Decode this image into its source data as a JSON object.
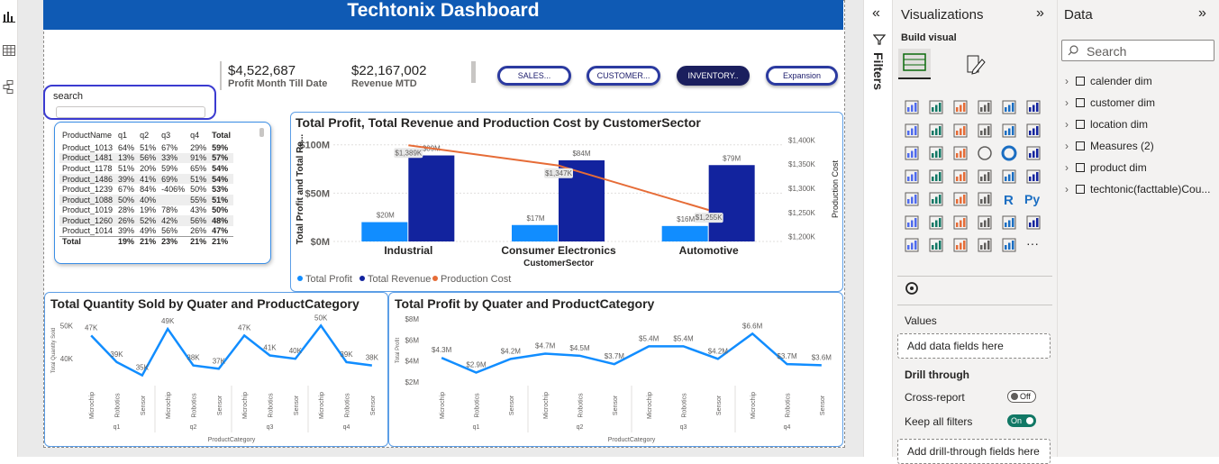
{
  "dashboard": {
    "title": "Techtonix Dashboard"
  },
  "kpis": [
    {
      "value": "$4,522,687",
      "label": "Profit Month Till Date"
    },
    {
      "value": "$22,167,002",
      "label": "Revenue MTD"
    }
  ],
  "nav_buttons": [
    "SALES...",
    "CUSTOMER...",
    "INVENTORY..",
    "Expansion"
  ],
  "search": {
    "label": "search"
  },
  "table": {
    "headers": [
      "ProductName",
      "q1",
      "q2",
      "q3",
      "q4",
      "Total"
    ],
    "rows": [
      [
        "Product_1013",
        "64%",
        "51%",
        "67%",
        "29%",
        "59%"
      ],
      [
        "Product_1481",
        "13%",
        "56%",
        "33%",
        "91%",
        "57%"
      ],
      [
        "Product_1178",
        "51%",
        "20%",
        "59%",
        "65%",
        "54%"
      ],
      [
        "Product_1486",
        "39%",
        "41%",
        "69%",
        "51%",
        "54%"
      ],
      [
        "Product_1239",
        "67%",
        "84%",
        "-406%",
        "50%",
        "53%"
      ],
      [
        "Product_1088",
        "50%",
        "40%",
        "",
        "55%",
        "51%"
      ],
      [
        "Product_1019",
        "28%",
        "19%",
        "78%",
        "43%",
        "50%"
      ],
      [
        "Product_1260",
        "26%",
        "52%",
        "42%",
        "56%",
        "48%"
      ],
      [
        "Product_1014",
        "39%",
        "49%",
        "56%",
        "26%",
        "47%"
      ]
    ],
    "total": [
      "Total",
      "19%",
      "21%",
      "23%",
      "21%",
      "21%"
    ]
  },
  "chart1": {
    "title": "Total Profit, Total Revenue and Production Cost by CustomerSector",
    "xlabel": "CustomerSector",
    "ylabel": "Total Profit and Total Re...",
    "y2label": "Production Cost",
    "yticks": [
      "$100M",
      "$50M",
      "$0M"
    ],
    "y2ticks": [
      "$1,400K",
      "$1,350K",
      "$1,300K",
      "$1,250K",
      "$1,200K"
    ],
    "legend": [
      "Total Profit",
      "Total Revenue",
      "Production Cost"
    ]
  },
  "chart2": {
    "title": "Total Quantity Sold by Quater and ProductCategory",
    "xlabel": "ProductCategory",
    "ylabel": "Total Quantity Sold",
    "yticks": [
      "50K",
      "40K"
    ]
  },
  "chart3": {
    "title": "Total Profit by Quater and ProductCategory",
    "xlabel": "ProductCategory",
    "ylabel": "Total Profit",
    "yticks": [
      "$8M",
      "$6M",
      "$4M",
      "$2M"
    ]
  },
  "chart_data": [
    {
      "type": "bar",
      "title": "Total Profit, Total Revenue and Production Cost by CustomerSector",
      "categories": [
        "Industrial",
        "Consumer Electronics",
        "Automotive"
      ],
      "series": [
        {
          "name": "Total Profit",
          "values": [
            20,
            17,
            16
          ],
          "labels": [
            "$20M",
            "$17M",
            "$16M"
          ]
        },
        {
          "name": "Total Revenue",
          "values": [
            89,
            84,
            79
          ],
          "labels": [
            "$89M",
            "$84M",
            "$79M"
          ]
        },
        {
          "name": "Production Cost",
          "values": [
            1389,
            1347,
            1255
          ],
          "labels": [
            "$1,389K",
            "$1,347K",
            "$1,255K"
          ],
          "axis": "secondary",
          "type": "line"
        }
      ],
      "ylim": [
        0,
        110
      ],
      "y2lim": [
        1190,
        1410
      ],
      "colors": {
        "Total Profit": "#118dff",
        "Total Revenue": "#12239e",
        "Production Cost": "#e66c37"
      }
    },
    {
      "type": "line",
      "title": "Total Quantity Sold by Quater and ProductCategory",
      "quarters": [
        "q1",
        "q2",
        "q3",
        "q4"
      ],
      "categories": [
        "Microchip",
        "Robotics",
        "Sensor"
      ],
      "values": [
        47,
        39,
        35,
        49,
        38,
        37,
        47,
        41,
        40,
        50,
        39,
        38
      ],
      "labels": [
        "47K",
        "39K",
        "35K",
        "49K",
        "38K",
        "37K",
        "47K",
        "41K",
        "40K",
        "50K",
        "39K",
        "38K"
      ],
      "ylim": [
        33,
        52
      ]
    },
    {
      "type": "line",
      "title": "Total Profit by Quater and ProductCategory",
      "quarters": [
        "q1",
        "q2",
        "q3",
        "q4"
      ],
      "categories": [
        "Microchip",
        "Robotics",
        "Sensor"
      ],
      "values": [
        4.3,
        2.9,
        4.2,
        4.7,
        4.5,
        3.7,
        5.4,
        5.4,
        4.2,
        6.6,
        3.7,
        3.6
      ],
      "labels": [
        "$4.3M",
        "$2.9M",
        "$4.2M",
        "$4.7M",
        "$4.5M",
        "$3.7M",
        "$5.4M",
        "$5.4M",
        "$4.2M",
        "$6.6M",
        "$3.7M",
        "$3.6M"
      ],
      "ylim": [
        2,
        8
      ]
    }
  ],
  "filters": {
    "label": "Filters"
  },
  "visualizations": {
    "title": "Visualizations",
    "build_visual": "Build visual",
    "values": "Values",
    "add_fields": "Add data fields here",
    "drill_through": "Drill through",
    "cross_report": "Cross-report",
    "cross_report_state": "Off",
    "keep_filters": "Keep all filters",
    "keep_filters_state": "On",
    "add_drill": "Add drill-through fields here"
  },
  "data_pane": {
    "title": "Data",
    "search_placeholder": "Search",
    "fields": [
      "calender dim",
      "customer dim",
      "location dim",
      "Measures (2)",
      "product dim",
      "techtonic(facttable)Cou..."
    ]
  }
}
